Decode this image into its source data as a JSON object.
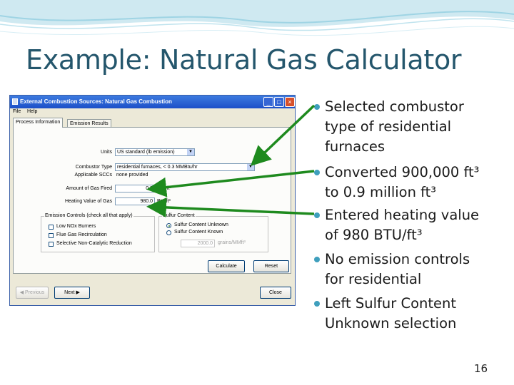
{
  "slide": {
    "title": "Example: Natural Gas Calculator",
    "page_number": "16",
    "accent_color": "#3f9fbd",
    "title_color": "#24566c",
    "arrow_color": "#1e8a1e"
  },
  "dialog": {
    "title": "External Combustion Sources: Natural Gas Combustion",
    "window_buttons": [
      "minimize-icon",
      "maximize-icon",
      "close-icon"
    ],
    "menu": [
      "File",
      "Help"
    ],
    "tabs": [
      "Process Information",
      "Emission Results"
    ],
    "units_label": "Units",
    "units_value": "US standard (lb emission)",
    "combustor_type_label": "Combustor Type",
    "combustor_type_value": "residential furnaces, < 0.3 MMBtu/hr",
    "applicable_sccs_label": "Applicable SCCs",
    "applicable_sccs_value": "none provided",
    "amount_label": "Amount of Gas Fired",
    "amount_value": "0.9",
    "amount_unit": "MM ft³",
    "heating_label": "Heating Value of Gas",
    "heating_value": "980.0",
    "heating_unit": "Btu/ft³",
    "emission_controls": {
      "title": "Emission Controls (check all that apply)",
      "options": [
        "Low NOx Burners",
        "Flue Gas Recirculation",
        "Selective Non-Catalytic Reduction"
      ]
    },
    "sulfur_content": {
      "title": "Sulfur Content",
      "options": [
        "Sulfur Content Unknown",
        "Sulfur Content Known"
      ],
      "selected": "Sulfur Content Unknown",
      "value": "2000.0",
      "unit": "grains/MMft³"
    },
    "buttons": {
      "calculate": "Calculate",
      "reset": "Reset",
      "previous": "Previous",
      "next": "Next",
      "close": "Close"
    }
  },
  "bullets": [
    {
      "lines": [
        "Selected combustor",
        "type of residential",
        "furnaces"
      ]
    },
    {
      "lines": [
        "Converted 900,000 ft³",
        "to 0.9 million ft³"
      ]
    },
    {
      "lines": [
        "Entered heating value",
        "of 980 BTU/ft³"
      ]
    },
    {
      "lines": [
        "No emission controls",
        "for residential"
      ]
    },
    {
      "lines": [
        "Left Sulfur Content",
        "Unknown selection"
      ]
    }
  ]
}
